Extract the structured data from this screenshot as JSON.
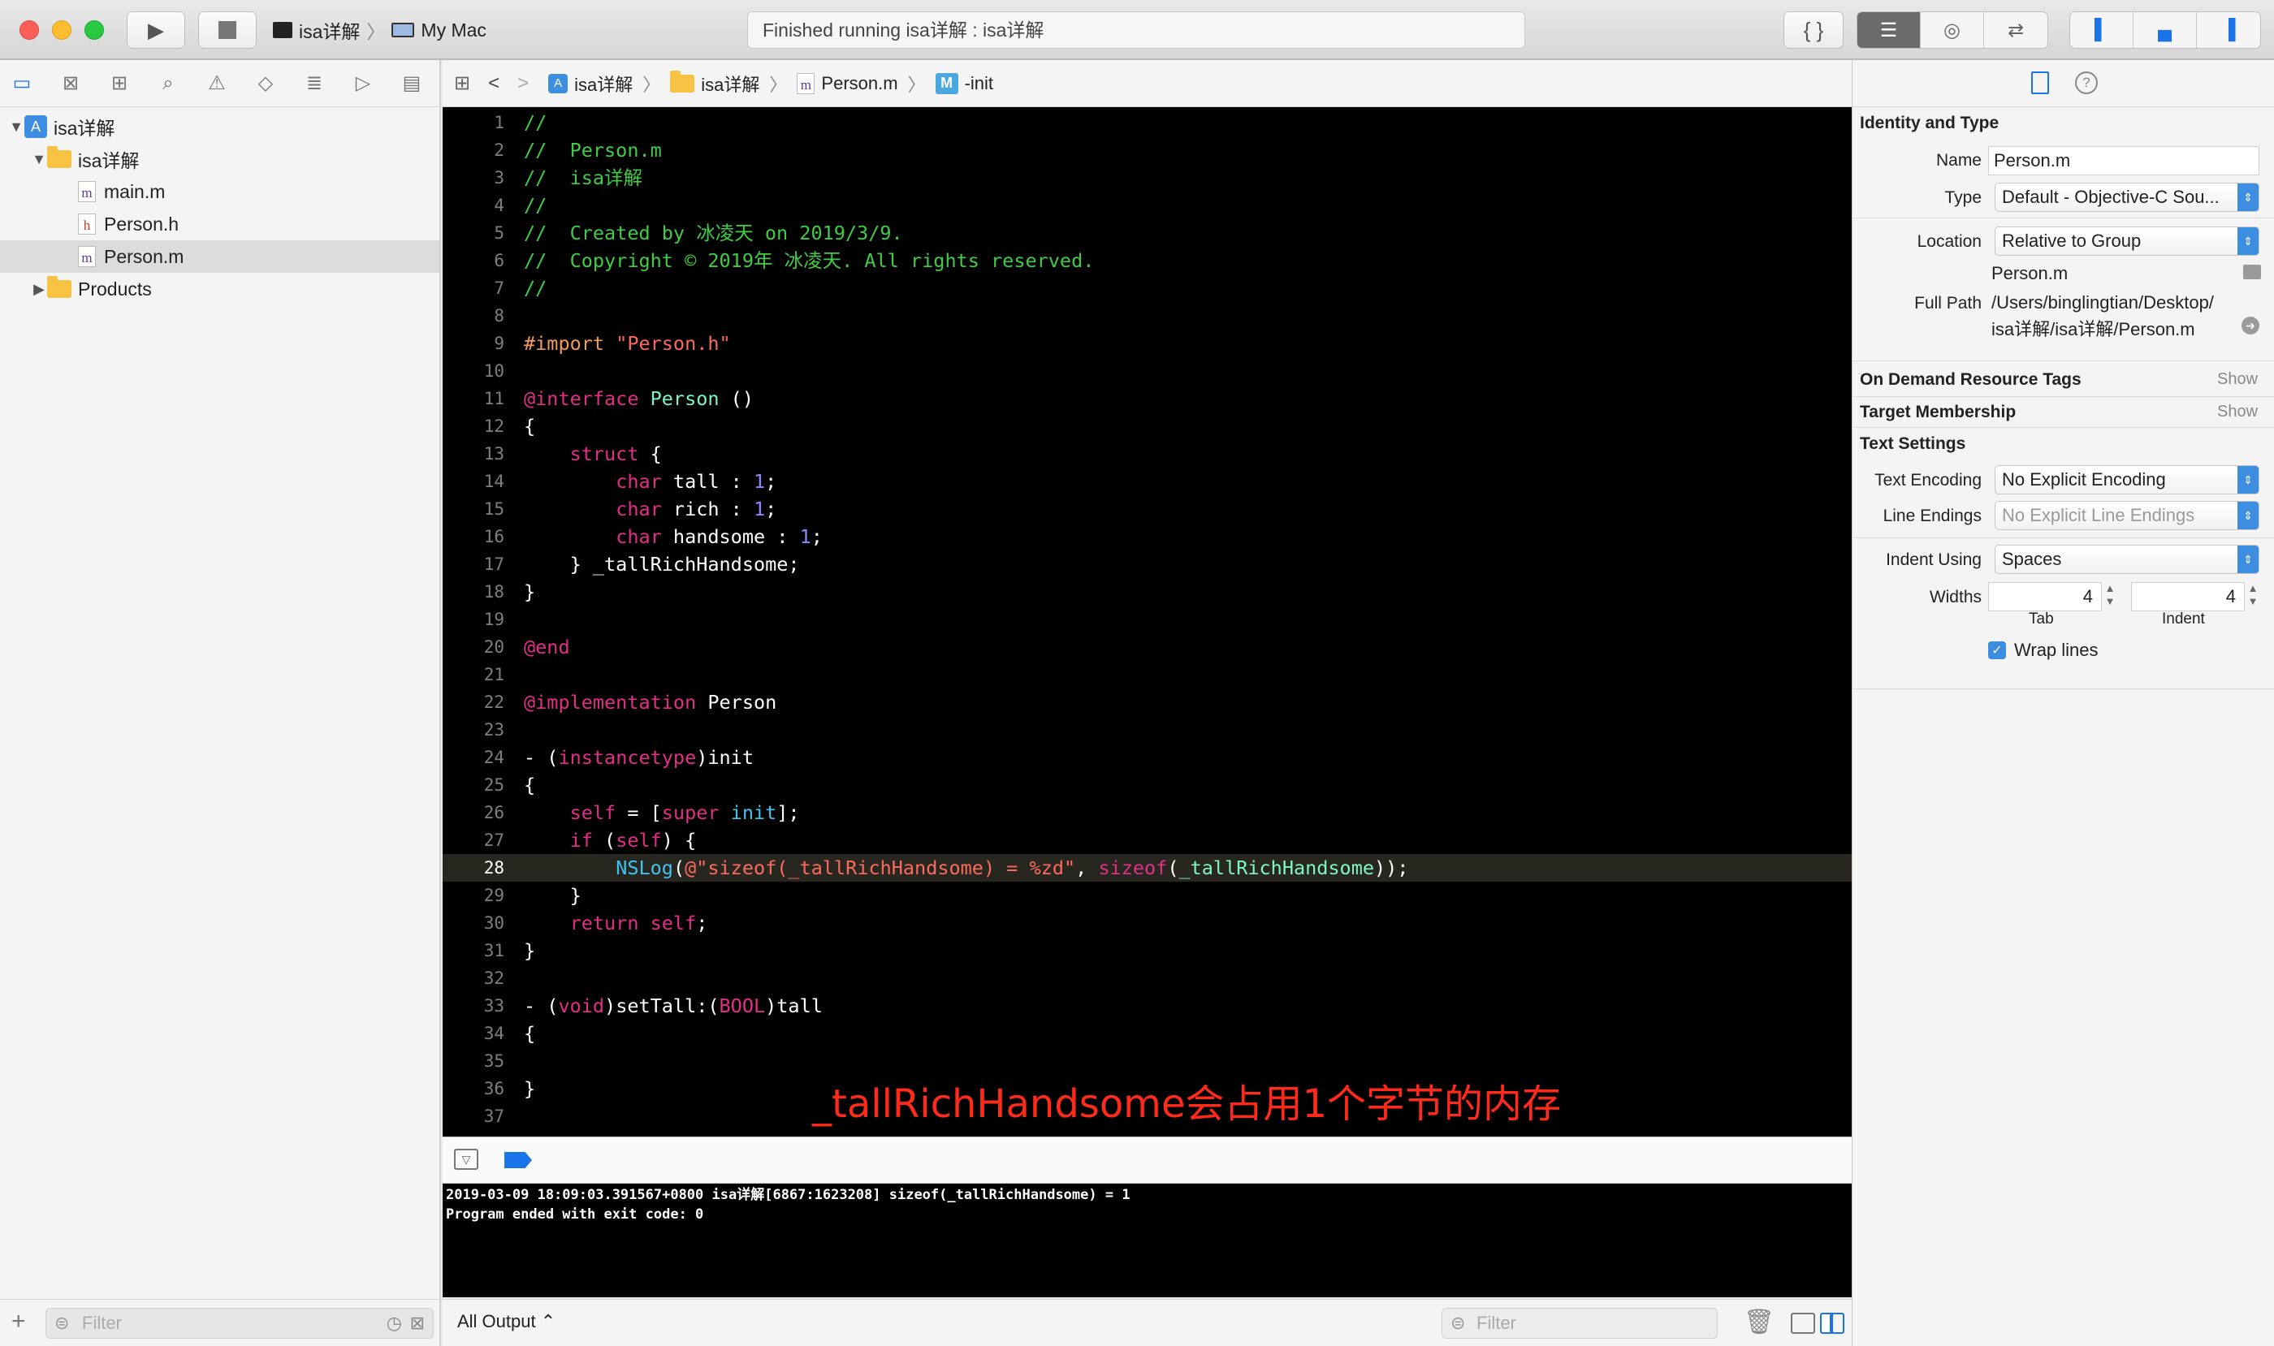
{
  "toolbar": {
    "scheme": "isa详解",
    "destination": "My Mac",
    "status": "Finished running isa详解 : isa详解"
  },
  "navigator": {
    "items": [
      {
        "label": "isa详解",
        "type": "project"
      },
      {
        "label": "isa详解",
        "type": "folder"
      },
      {
        "label": "main.m",
        "type": "m"
      },
      {
        "label": "Person.h",
        "type": "h"
      },
      {
        "label": "Person.m",
        "type": "m",
        "selected": true
      },
      {
        "label": "Products",
        "type": "folder"
      }
    ],
    "filter_placeholder": "Filter"
  },
  "jumpbar": {
    "crumbs": [
      "isa详解",
      "isa详解",
      "Person.m",
      "-init"
    ]
  },
  "editor": {
    "current_line": 28,
    "lines": [
      {
        "n": "1",
        "html": "<span class='c-comment'>//</span>"
      },
      {
        "n": "2",
        "html": "<span class='c-comment'>//  Person.m</span>"
      },
      {
        "n": "3",
        "html": "<span class='c-comment'>//  isa详解</span>"
      },
      {
        "n": "4",
        "html": "<span class='c-comment'>//</span>"
      },
      {
        "n": "5",
        "html": "<span class='c-comment'>//  Created by 冰凌天 on 2019/3/9.</span>"
      },
      {
        "n": "6",
        "html": "<span class='c-comment'>//  Copyright © 2019年 冰凌天. All rights reserved.</span>"
      },
      {
        "n": "7",
        "html": "<span class='c-comment'>//</span>"
      },
      {
        "n": "8",
        "html": ""
      },
      {
        "n": "9",
        "html": "<span class='c-pre'>#import </span><span class='c-str'>\"Person.h\"</span>"
      },
      {
        "n": "10",
        "html": ""
      },
      {
        "n": "11",
        "html": "<span class='c-kw'>@interface</span> <span class='c-cls'>Person</span> ()"
      },
      {
        "n": "12",
        "html": "{"
      },
      {
        "n": "13",
        "html": "    <span class='c-kw'>struct</span> {"
      },
      {
        "n": "14",
        "html": "        <span class='c-kw'>char</span> tall : <span class='c-num'>1</span>;"
      },
      {
        "n": "15",
        "html": "        <span class='c-kw'>char</span> rich : <span class='c-num'>1</span>;"
      },
      {
        "n": "16",
        "html": "        <span class='c-kw'>char</span> handsome : <span class='c-num'>1</span>;"
      },
      {
        "n": "17",
        "html": "    } _tallRichHandsome;"
      },
      {
        "n": "18",
        "html": "}"
      },
      {
        "n": "19",
        "html": ""
      },
      {
        "n": "20",
        "html": "<span class='c-kw'>@end</span>"
      },
      {
        "n": "21",
        "html": ""
      },
      {
        "n": "22",
        "html": "<span class='c-kw'>@implementation</span> Person"
      },
      {
        "n": "23",
        "html": ""
      },
      {
        "n": "24",
        "html": "- (<span class='c-kw'>instancetype</span>)init"
      },
      {
        "n": "25",
        "html": "{"
      },
      {
        "n": "26",
        "html": "    <span class='c-kw'>self</span> = [<span class='c-kw'>super</span> <span class='c-fn'>init</span>];"
      },
      {
        "n": "27",
        "html": "    <span class='c-kw'>if</span> (<span class='c-kw'>self</span>) {"
      },
      {
        "n": "28",
        "html": "        <span class='c-fn'>NSLog</span>(<span class='c-str'>@\"sizeof(_tallRichHandsome) = %zd\"</span>, <span class='c-kw'>sizeof</span>(<span class='c-cls'>_tallRichHandsome</span>));"
      },
      {
        "n": "29",
        "html": "    }"
      },
      {
        "n": "30",
        "html": "    <span class='c-kw'>return</span> <span class='c-kw'>self</span>;"
      },
      {
        "n": "31",
        "html": "}"
      },
      {
        "n": "32",
        "html": ""
      },
      {
        "n": "33",
        "html": "- (<span class='c-kw'>void</span>)setTall:(<span class='c-kw'>BOOL</span>)tall"
      },
      {
        "n": "34",
        "html": "{"
      },
      {
        "n": "35",
        "html": ""
      },
      {
        "n": "36",
        "html": "}"
      },
      {
        "n": "37",
        "html": ""
      }
    ],
    "annotation": "_tallRichHandsome会占用1个字节的内存"
  },
  "console": {
    "output": "2019-03-09 18:09:03.391567+0800 isa详解[6867:1623208] sizeof(_tallRichHandsome) = 1\nProgram ended with exit code: 0",
    "output_selector": "All Output ⌃",
    "filter_placeholder": "Filter"
  },
  "inspector": {
    "identity_title": "Identity and Type",
    "name_label": "Name",
    "name_value": "Person.m",
    "type_label": "Type",
    "type_value": "Default - Objective-C Sou...",
    "location_label": "Location",
    "location_value": "Relative to Group",
    "location_file": "Person.m",
    "fullpath_label": "Full Path",
    "fullpath_line1": "/Users/binglingtian/Desktop/",
    "fullpath_line2": "isa详解/isa详解/Person.m",
    "odr_title": "On Demand Resource Tags",
    "target_title": "Target Membership",
    "show_label": "Show",
    "text_settings_title": "Text Settings",
    "encoding_label": "Text Encoding",
    "encoding_value": "No Explicit Encoding",
    "endings_label": "Line Endings",
    "endings_value": "No Explicit Line Endings",
    "indent_label": "Indent Using",
    "indent_value": "Spaces",
    "widths_label": "Widths",
    "tab_value": "4",
    "indent_width_value": "4",
    "tab_caption": "Tab",
    "indent_caption": "Indent",
    "wrap_label": "Wrap lines"
  }
}
